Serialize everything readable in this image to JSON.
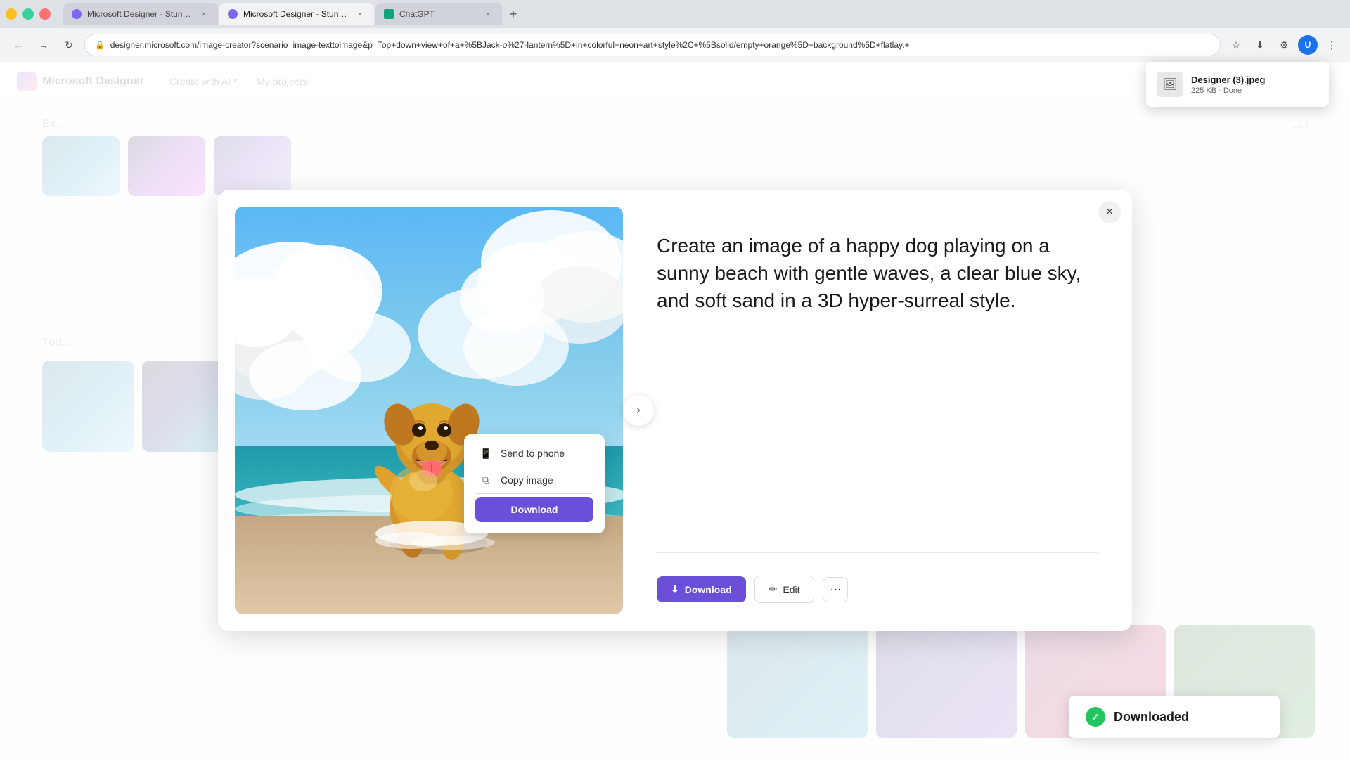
{
  "browser": {
    "tabs": [
      {
        "id": "tab1",
        "label": "Microsoft Designer - Stunning ...",
        "favicon": "designer",
        "active": false
      },
      {
        "id": "tab2",
        "label": "Microsoft Designer - Stunning ...",
        "favicon": "designer",
        "active": true
      },
      {
        "id": "tab3",
        "label": "ChatGPT",
        "favicon": "chatgpt",
        "active": false
      }
    ],
    "new_tab_label": "+",
    "address": "designer.microsoft.com/image-creator?scenario=image-texttoimage&p=Top+down+view+of+a+%5BJack-o%27-lantern%5D+in+colorful+neon+art+style%2C+%5Bsolid/empty+orange%5D+background%5D+flatlay.+",
    "nav": {
      "back": "←",
      "forward": "→",
      "refresh": "↻"
    },
    "download_popup": {
      "filename": "Designer (3).jpeg",
      "meta": "225 KB · Done",
      "icon": "📄"
    }
  },
  "app": {
    "logo_text": "Microsoft Designer",
    "nav_items": [
      {
        "label": "Create with AI",
        "has_chevron": true
      },
      {
        "label": "My projects",
        "has_chevron": false
      }
    ],
    "header_right": "···"
  },
  "modal": {
    "close_label": "×",
    "prompt_text": "Create an image of a happy dog playing on a sunny beach with gentle waves, a clear blue sky, and soft sand in a 3D hyper-surreal style.",
    "actions": {
      "download_label": "Download",
      "edit_label": "Edit",
      "more_label": "···"
    },
    "dropdown": {
      "items": [
        {
          "label": "Send to phone",
          "icon": "📱"
        },
        {
          "label": "Copy image",
          "icon": "⧉"
        }
      ],
      "download_btn_label": "Download"
    },
    "nav_arrow": "›"
  },
  "toast": {
    "label": "Downloaded",
    "icon": "✓"
  },
  "background": {
    "explore_label": "Ex...",
    "today_label": "Tod...",
    "right_label": "...ut"
  }
}
